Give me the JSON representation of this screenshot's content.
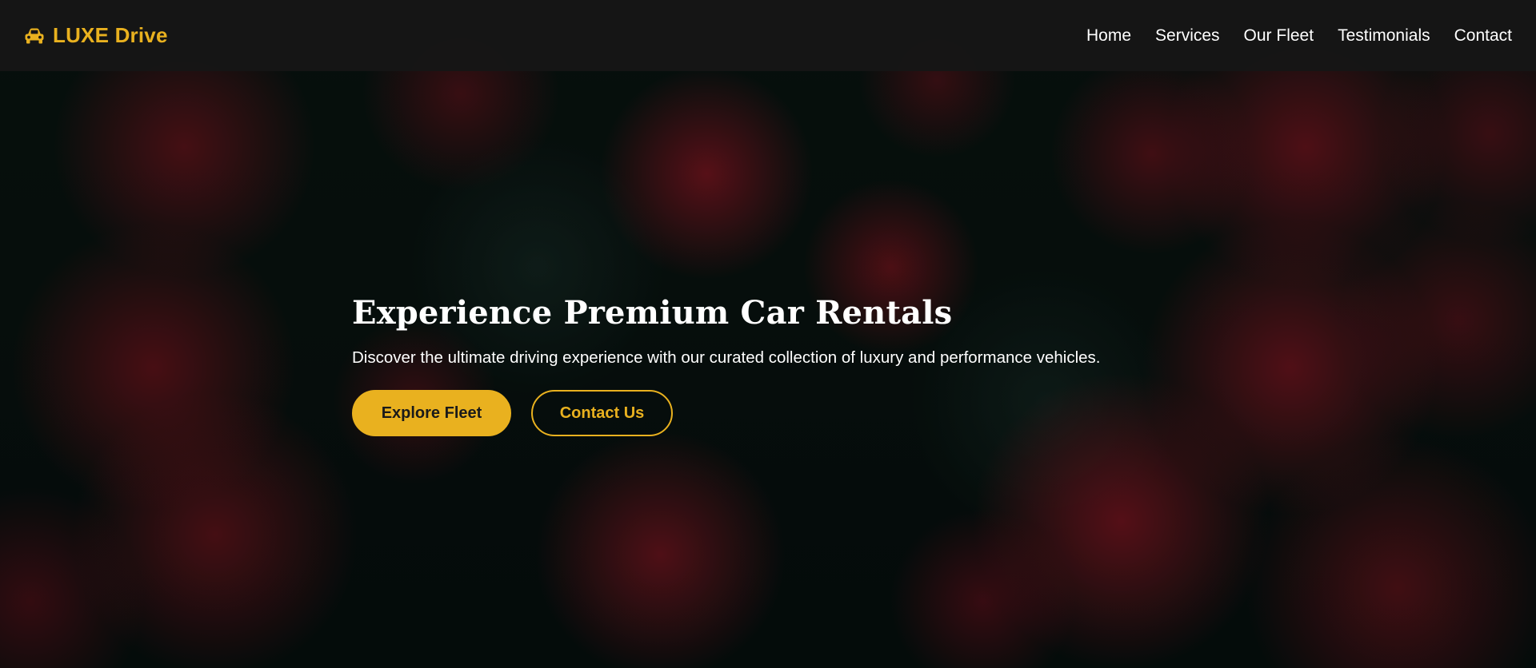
{
  "navbar": {
    "brand": {
      "icon": "car-icon",
      "label": "LUXE Drive"
    },
    "links": [
      {
        "label": "Home"
      },
      {
        "label": "Services"
      },
      {
        "label": "Our Fleet"
      },
      {
        "label": "Testimonials"
      },
      {
        "label": "Contact"
      }
    ]
  },
  "hero": {
    "title": "Experience Premium Car Rentals",
    "subtitle": "Discover the ultimate driving experience with our curated collection of luxury and performance vehicles.",
    "primary_button": "Explore Fleet",
    "secondary_button": "Contact Us",
    "background": "dark red roses"
  },
  "colors": {
    "accent": "#e9b11f",
    "navbar_bg": "#161616",
    "text": "#ffffff"
  }
}
